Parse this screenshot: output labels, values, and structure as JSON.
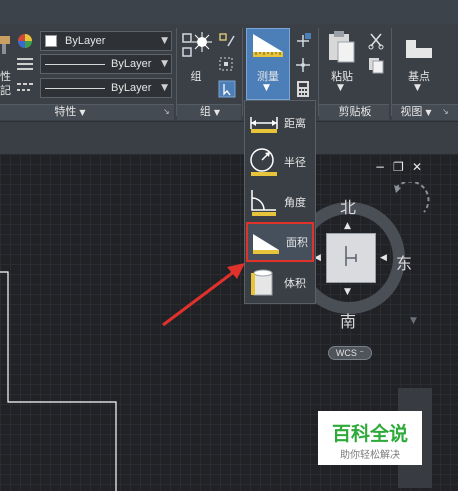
{
  "properties_panel": {
    "color_value": "ByLayer",
    "linetype_value": "ByLayer",
    "lineweight_value": "ByLayer",
    "footer_label": "特性",
    "left_clipped_label_1": "性",
    "left_clipped_label_2": "記"
  },
  "groups_panel": {
    "group_button_label": "组",
    "footer_label": "组"
  },
  "utilities_panel": {
    "measure_button_label": "测量"
  },
  "clipboard_panel": {
    "paste_button_label": "粘贴",
    "footer_label": "剪贴板"
  },
  "view_panel": {
    "base_button_label": "基点",
    "footer_label": "视图"
  },
  "measure_menu": {
    "items": [
      {
        "label": "距离",
        "icon": "distance-icon"
      },
      {
        "label": "半径",
        "icon": "radius-icon"
      },
      {
        "label": "角度",
        "icon": "angle-icon"
      },
      {
        "label": "面积",
        "icon": "area-icon",
        "selected": true
      },
      {
        "label": "体积",
        "icon": "volume-icon"
      }
    ]
  },
  "viewcube": {
    "north": "北",
    "south": "南",
    "east": "东",
    "wcs_label": "WCS"
  },
  "window_controls": {
    "minimize": "−",
    "restore": "❐",
    "close": "✕"
  },
  "watermark": {
    "title": "百科全说",
    "subtitle": "助你轻松解决"
  },
  "colors": {
    "highlight_border": "#e0312b",
    "arrow": "#e0312b",
    "active_button": "#4c7fb8",
    "watermark_green": "#2eaa3a"
  }
}
